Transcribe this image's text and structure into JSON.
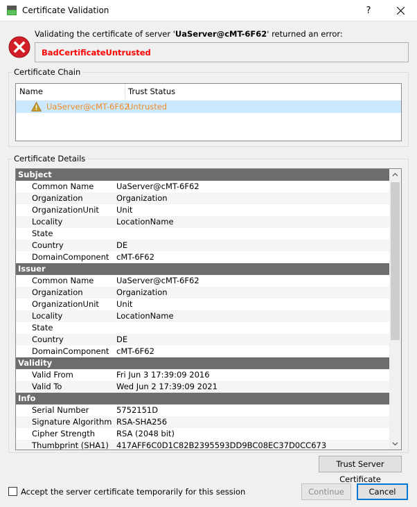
{
  "window": {
    "title": "Certificate Validation",
    "help_label": "?"
  },
  "message": {
    "prefix": "Validating the certificate of server '",
    "server": "UaServer@cMT-6F62",
    "suffix": "' returned an error:",
    "error_code": "BadCertificateUntrusted"
  },
  "chain": {
    "group_title": "Certificate Chain",
    "columns": [
      "Name",
      "Trust Status"
    ],
    "rows": [
      {
        "name": "UaServer@cMT-6F62",
        "status": "Untrusted"
      }
    ]
  },
  "details": {
    "group_title": "Certificate Details",
    "sections": [
      {
        "title": "Subject",
        "fields": [
          {
            "key": "Common Name",
            "value": "UaServer@cMT-6F62"
          },
          {
            "key": "Organization",
            "value": "Organization"
          },
          {
            "key": "OrganizationUnit",
            "value": "Unit"
          },
          {
            "key": "Locality",
            "value": "LocationName"
          },
          {
            "key": "State",
            "value": ""
          },
          {
            "key": "Country",
            "value": "DE"
          },
          {
            "key": "DomainComponent",
            "value": "cMT-6F62"
          }
        ]
      },
      {
        "title": "Issuer",
        "fields": [
          {
            "key": "Common Name",
            "value": "UaServer@cMT-6F62"
          },
          {
            "key": "Organization",
            "value": "Organization"
          },
          {
            "key": "OrganizationUnit",
            "value": "Unit"
          },
          {
            "key": "Locality",
            "value": "LocationName"
          },
          {
            "key": "State",
            "value": ""
          },
          {
            "key": "Country",
            "value": "DE"
          },
          {
            "key": "DomainComponent",
            "value": "cMT-6F62"
          }
        ]
      },
      {
        "title": "Validity",
        "fields": [
          {
            "key": "Valid From",
            "value": "Fri Jun 3 17:39:09 2016"
          },
          {
            "key": "Valid To",
            "value": "Wed Jun 2 17:39:09 2021"
          }
        ]
      },
      {
        "title": "Info",
        "fields": [
          {
            "key": "Serial Number",
            "value": "5752151D"
          },
          {
            "key": "Signature Algorithm",
            "value": "RSA-SHA256"
          },
          {
            "key": "Cipher Strength",
            "value": "RSA (2048 bit)"
          },
          {
            "key": "Thumbprint (SHA1)",
            "value": "417AFF6C0D1C82B2395593DD9BC08EC37D0CC673"
          }
        ]
      }
    ]
  },
  "buttons": {
    "trust": "Trust Server Certificate",
    "continue": "Continue",
    "cancel": "Cancel"
  },
  "checkbox": {
    "label": "Accept the server certificate temporarily for this session",
    "checked": false
  },
  "colors": {
    "error": "#ff0000",
    "untrusted": "#f08b22",
    "selection": "#cce8ff",
    "section_header": "#6d6d6d"
  },
  "icons": {
    "app": "certificate-app-icon",
    "error": "error-x-icon",
    "warning": "warning-triangle-icon",
    "close": "close-icon"
  }
}
